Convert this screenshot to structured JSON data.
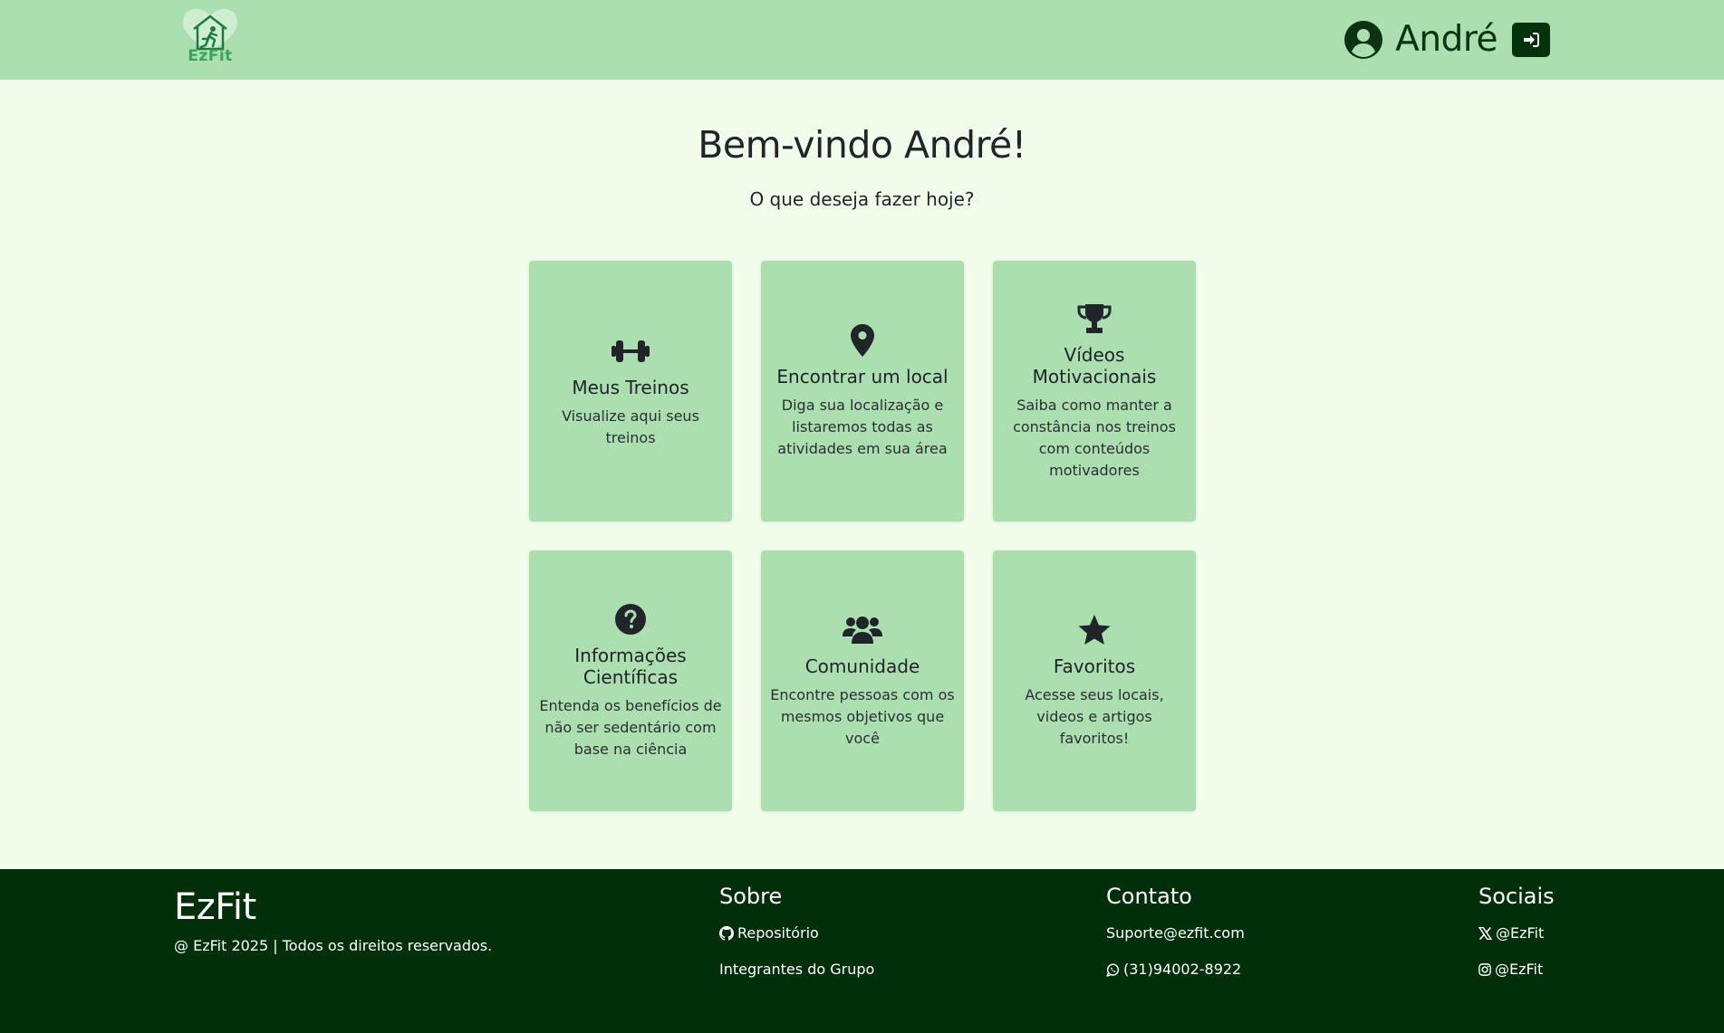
{
  "header": {
    "logo_text": "EzFit",
    "user_name": "André",
    "user_icon": "user-circle-icon",
    "logout_icon": "sign-in-icon"
  },
  "main": {
    "welcome": "Bem-vindo André!",
    "subtitle": "O que deseja fazer hoje?",
    "cards": [
      {
        "title": "Meus Treinos",
        "description": "Visualize aqui seus treinos",
        "icon": "dumbbell-icon"
      },
      {
        "title": "Encontrar um local",
        "description": "Diga sua localização e listaremos todas as atividades em sua área",
        "icon": "location-pin-icon"
      },
      {
        "title": "Vídeos Motivacionais",
        "description": "Saiba como manter a constância nos treinos com conteúdos motivadores",
        "icon": "trophy-icon"
      },
      {
        "title": "Informações Científicas",
        "description": "Entenda os benefícios de não ser sedentário com base na ciência",
        "icon": "question-circle-icon"
      },
      {
        "title": "Comunidade",
        "description": "Encontre pessoas com os mesmos objetivos que você",
        "icon": "users-icon"
      },
      {
        "title": "Favoritos",
        "description": "Acesse seus locais, videos e artigos favoritos!",
        "icon": "star-icon"
      }
    ]
  },
  "footer": {
    "brand": "EzFit",
    "copyright": "@ EzFit 2025 | Todos os direitos reservados.",
    "sobre": {
      "title": "Sobre",
      "links": [
        {
          "label": "Repositório",
          "icon": "github-icon"
        },
        {
          "label": "Integrantes do Grupo",
          "icon": ""
        }
      ]
    },
    "contato": {
      "title": "Contato",
      "links": [
        {
          "label": "Suporte@ezfit.com",
          "icon": ""
        },
        {
          "label": "(31)94002-8922",
          "icon": "whatsapp-icon"
        }
      ]
    },
    "sociais": {
      "title": "Sociais",
      "links": [
        {
          "label": "@EzFit",
          "icon": "x-twitter-icon"
        },
        {
          "label": "@EzFit",
          "icon": "instagram-icon"
        }
      ]
    }
  },
  "colors": {
    "header_bg": "#abdfaf",
    "page_bg": "#f1fdeb",
    "card_bg": "#abdfaf",
    "footer_bg": "#012f09",
    "accent_dark": "#03330b",
    "logo_green": "#3aa55e"
  }
}
